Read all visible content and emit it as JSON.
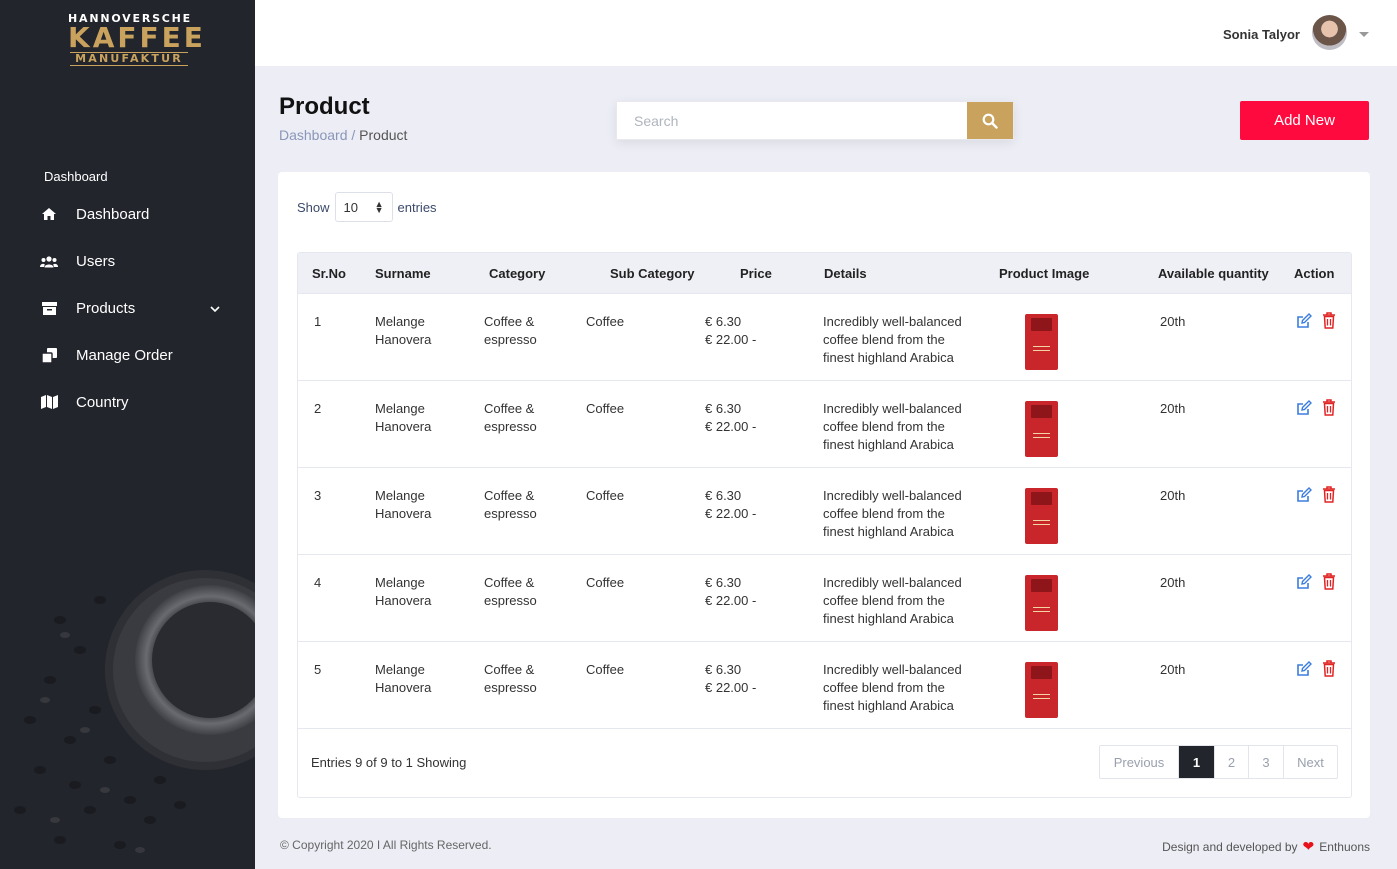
{
  "brand": {
    "line1": "HANNOVERSCHE",
    "line2": "KAFFEE",
    "line3": "MANUFAKTUR"
  },
  "sidebar": {
    "heading": "Dashboard",
    "items": [
      {
        "label": "Dashboard",
        "icon": "home-icon"
      },
      {
        "label": "Users",
        "icon": "users-icon"
      },
      {
        "label": "Products",
        "icon": "archive-icon"
      },
      {
        "label": "Manage Order",
        "icon": "clone-icon"
      },
      {
        "label": "Country",
        "icon": "map-icon"
      }
    ]
  },
  "topbar": {
    "user_name": "Sonia Talyor"
  },
  "page": {
    "title": "Product",
    "breadcrumb_parent": "Dashboard",
    "breadcrumb_sep": " / ",
    "breadcrumb_current": "Product"
  },
  "search": {
    "placeholder": "Search"
  },
  "actions": {
    "add_new": "Add New"
  },
  "entries": {
    "show_label": "Show",
    "value": "10",
    "entries_label": "entries"
  },
  "table": {
    "headers": [
      "Sr.No",
      "Surname",
      "Category",
      "Sub Category",
      "Price",
      "Details",
      "Product Image",
      "Available quantity",
      "Action"
    ],
    "rows": [
      {
        "sr": "1",
        "surname_l1": "Melange",
        "surname_l2": "Hanovera",
        "cat_l1": "Coffee &",
        "cat_l2": "espresso",
        "sub": "Coffee",
        "price_l1": "€ 6.30",
        "price_l2": "€ 22.00 -",
        "det_l1": "Incredibly well-balanced",
        "det_l2": "coffee blend from the",
        "det_l3": "finest highland Arabica",
        "qty": "20th"
      },
      {
        "sr": "2",
        "surname_l1": "Melange",
        "surname_l2": "Hanovera",
        "cat_l1": "Coffee &",
        "cat_l2": "espresso",
        "sub": "Coffee",
        "price_l1": "€ 6.30",
        "price_l2": "€ 22.00 -",
        "det_l1": "Incredibly well-balanced",
        "det_l2": "coffee blend from the",
        "det_l3": "finest highland Arabica",
        "qty": "20th"
      },
      {
        "sr": "3",
        "surname_l1": "Melange",
        "surname_l2": "Hanovera",
        "cat_l1": "Coffee &",
        "cat_l2": "espresso",
        "sub": "Coffee",
        "price_l1": "€ 6.30",
        "price_l2": "€ 22.00 -",
        "det_l1": "Incredibly well-balanced",
        "det_l2": "coffee blend from the",
        "det_l3": "finest highland Arabica",
        "qty": "20th"
      },
      {
        "sr": "4",
        "surname_l1": "Melange",
        "surname_l2": "Hanovera",
        "cat_l1": "Coffee &",
        "cat_l2": "espresso",
        "sub": "Coffee",
        "price_l1": "€ 6.30",
        "price_l2": "€ 22.00 -",
        "det_l1": "Incredibly well-balanced",
        "det_l2": "coffee blend from the",
        "det_l3": "finest highland Arabica",
        "qty": "20th"
      },
      {
        "sr": "5",
        "surname_l1": "Melange",
        "surname_l2": "Hanovera",
        "cat_l1": "Coffee &",
        "cat_l2": "espresso",
        "sub": "Coffee",
        "price_l1": "€ 6.30",
        "price_l2": "€ 22.00 -",
        "det_l1": "Incredibly well-balanced",
        "det_l2": "coffee blend from the",
        "det_l3": "finest highland Arabica",
        "qty": "20th"
      }
    ],
    "info": "Entries 9 of 9 to 1 Showing"
  },
  "pagination": {
    "previous": "Previous",
    "pages": [
      "1",
      "2",
      "3"
    ],
    "active_page": "1",
    "next": "Next"
  },
  "footer": {
    "copyright": "© Copyright 2020 I All Rights Reserved.",
    "credit_prefix": "Design and developed by",
    "credit_name": "Enthuons"
  },
  "colors": {
    "sidebar": "#22252c",
    "accent_gold": "#c9a25e",
    "add_button": "#ff0a3e",
    "edit_icon": "#3b7ddd",
    "delete_icon": "#e02424"
  }
}
